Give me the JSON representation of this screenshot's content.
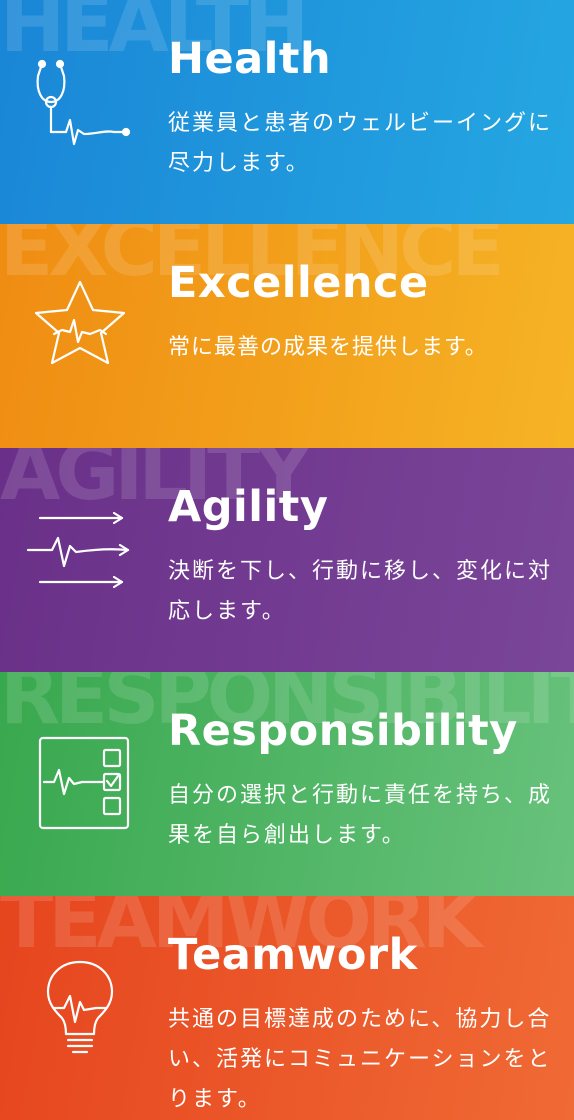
{
  "panels": [
    {
      "id": "health",
      "watermark": "HEALTH",
      "title": "Health",
      "description": "従業員と患者のウェルビーイングに尽力します。",
      "icon": "stethoscope-icon",
      "color_start": "#1a86d6",
      "color_end": "#25a7e2"
    },
    {
      "id": "excellence",
      "watermark": "EXCELLENCE",
      "title": "Excellence",
      "description": "常に最善の成果を提供します。",
      "icon": "star-heartbeat-icon",
      "color_start": "#ef8c12",
      "color_end": "#f6b425"
    },
    {
      "id": "agility",
      "watermark": "AGILITY",
      "title": "Agility",
      "description": "決断を下し、行動に移し、変化に対応します。",
      "icon": "arrows-heartbeat-icon",
      "color_start": "#6a3089",
      "color_end": "#7a4699"
    },
    {
      "id": "responsibility",
      "watermark": "RESPONSIBILITY",
      "title": "Responsibility",
      "description": "自分の選択と行動に責任を持ち、成果を自ら創出します。",
      "icon": "checklist-monitor-icon",
      "color_start": "#38a84e",
      "color_end": "#68c27c"
    },
    {
      "id": "teamwork",
      "watermark": "TEAMWORK",
      "title": "Teamwork",
      "description": "共通の目標達成のために、協力し合い、活発にコミュニケーションをとります。",
      "icon": "lightbulb-icon",
      "color_start": "#e6451e",
      "color_end": "#f06a35"
    }
  ]
}
